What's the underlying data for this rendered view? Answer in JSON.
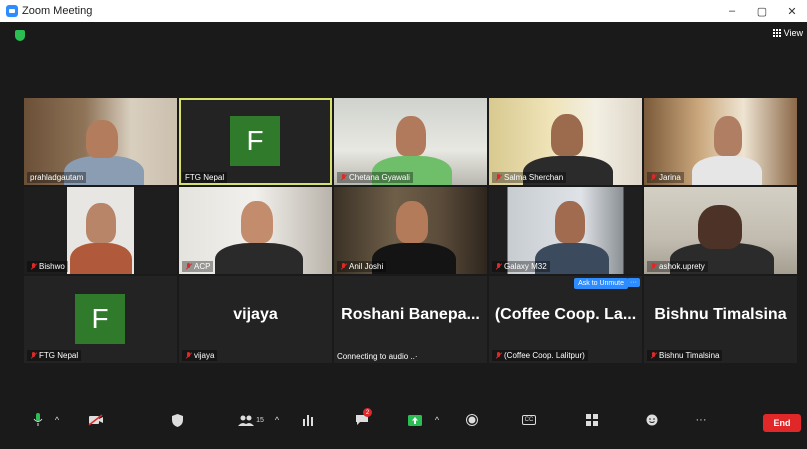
{
  "window": {
    "title": "Zoom Meeting",
    "minimize": "–",
    "maximize": "▢",
    "close": "✕"
  },
  "top": {
    "view_label": "View"
  },
  "tiles": [
    {
      "name": "prahladgautam",
      "muted": false
    },
    {
      "name": "FTG Nepal",
      "muted": false,
      "avatar": "F"
    },
    {
      "name": "Chetana Gyawali",
      "muted": true
    },
    {
      "name": "Salma Sherchan",
      "muted": true
    },
    {
      "name": "Jarina",
      "muted": true
    },
    {
      "name": "Bishwo",
      "muted": true
    },
    {
      "name": "ACP",
      "muted": true
    },
    {
      "name": "Anil Joshi",
      "muted": true
    },
    {
      "name": "Galaxy M32",
      "muted": true
    },
    {
      "name": "ashok.uprety",
      "muted": true
    },
    {
      "name": "FTG Nepal",
      "muted": true,
      "avatar": "F"
    },
    {
      "name": "vijaya",
      "muted": true,
      "big": "vijaya"
    },
    {
      "name": "Connecting to audio ..·",
      "big": "Roshani   Banepa..."
    },
    {
      "name": "(Coffee Coop. Lalitpur)",
      "muted": true,
      "big": "(Coffee Coop. La...",
      "ask": "Ask to Unmute",
      "more": "···"
    },
    {
      "name": "Bishnu Timalsina",
      "muted": true,
      "big": "Bishnu Timalsina"
    }
  ],
  "toolbar": {
    "participants_count": "15",
    "end_label": "End",
    "chat_badge": "2",
    "cc_label": "CC",
    "more_label": "···",
    "caret": "^"
  },
  "colors": {
    "accent": "#2d8cff",
    "end": "#e02828",
    "active_border": "#d6e06c",
    "avatar_bg": "#2f7a2b"
  }
}
